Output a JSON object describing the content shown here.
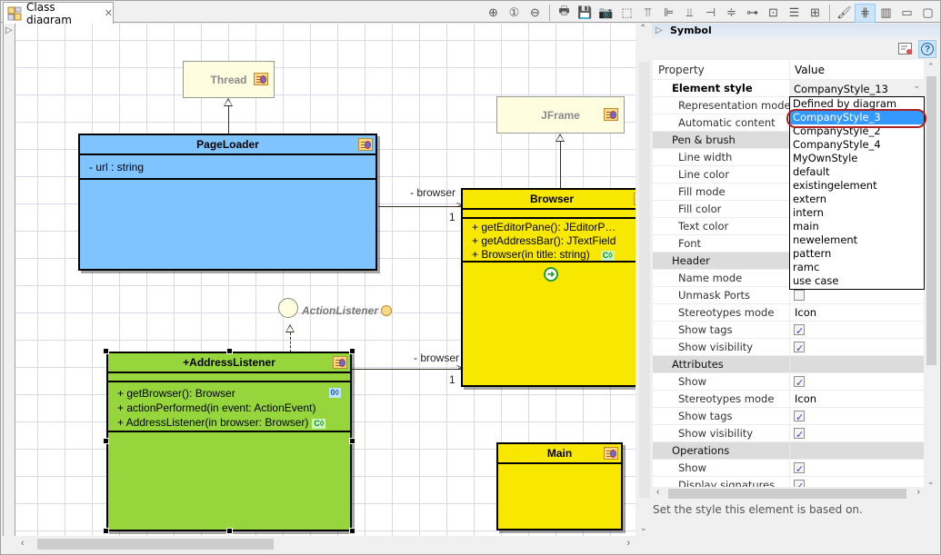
{
  "editor": {
    "tab_label": "Class diagram",
    "tab_icon": "class-diagram-icon",
    "close_glyph": "✕"
  },
  "toolbar": {
    "buttons": [
      {
        "name": "zoom-in",
        "glyph": "⊕"
      },
      {
        "name": "zoom-reset",
        "glyph": "①"
      },
      {
        "name": "zoom-out",
        "glyph": "⊖"
      },
      {
        "name": "print",
        "glyph": "🖶"
      },
      {
        "name": "save",
        "glyph": "💾"
      },
      {
        "name": "screenshot",
        "glyph": "📷"
      },
      {
        "name": "select-area",
        "glyph": "⬚"
      },
      {
        "name": "align-top",
        "glyph": "⫪"
      },
      {
        "name": "align-left",
        "glyph": "⊫"
      },
      {
        "name": "align-bottom",
        "glyph": "⫫"
      },
      {
        "name": "align-right",
        "glyph": "⊣"
      },
      {
        "name": "center-horizontal",
        "glyph": "≑"
      },
      {
        "name": "center-vertical",
        "glyph": "⊶"
      },
      {
        "name": "same-width",
        "glyph": "⊡"
      },
      {
        "name": "same-height",
        "glyph": "☰"
      },
      {
        "name": "same-size",
        "glyph": "⊞"
      },
      {
        "name": "style-brush",
        "glyph": "🖌"
      },
      {
        "name": "grid-toggle",
        "glyph": "⋕"
      },
      {
        "name": "split-view",
        "glyph": "▥"
      },
      {
        "name": "minimize",
        "glyph": "▭"
      },
      {
        "name": "maximize",
        "glyph": "▢"
      }
    ]
  },
  "diagram": {
    "classes": {
      "thread": {
        "name": "Thread"
      },
      "jframe": {
        "name": "JFrame"
      },
      "pageloader": {
        "name": "PageLoader",
        "attributes": [
          "- url : string"
        ],
        "color": "#80c4ff"
      },
      "browser": {
        "name": "Browser",
        "color": "#f8e800",
        "operations": [
          "+ getEditorPane(): JEditorP…",
          "+ getAddressBar(): JTextField",
          "+ Browser(in title: string)"
        ],
        "constructor_badge": "C◊"
      },
      "addresslistener": {
        "name": "+AddressListener",
        "color": "#96d63c",
        "operations": [
          "+ getBrowser(): Browser",
          "+ actionPerformed(in event: ActionEvent)",
          "+ AddressListener(in browser: Browser)"
        ],
        "getter_badge": "0◊",
        "constructor_badge": "C◊"
      },
      "main": {
        "name": "Main",
        "color": "#f8e800"
      }
    },
    "interface": {
      "name": "ActionListener"
    },
    "associations": [
      {
        "role": "- browser",
        "multiplicity": "1"
      },
      {
        "role": "- browser",
        "multiplicity": "1"
      }
    ]
  },
  "properties": {
    "section_title": "Symbol",
    "columns": {
      "property": "Property",
      "value": "Value"
    },
    "element_style": {
      "label": "Element style",
      "value": "CompanyStyle_13"
    },
    "rows": [
      {
        "label": "Representation mode",
        "type": "text",
        "value": ""
      },
      {
        "label": "Automatic content",
        "type": "text",
        "value": ""
      },
      {
        "label": "Pen & brush",
        "type": "category"
      },
      {
        "label": "Line width",
        "type": "text",
        "value": ""
      },
      {
        "label": "Line color",
        "type": "text",
        "value": ""
      },
      {
        "label": "Fill mode",
        "type": "text",
        "value": ""
      },
      {
        "label": "Fill color",
        "type": "text",
        "value": ""
      },
      {
        "label": "Text color",
        "type": "text",
        "value": ""
      },
      {
        "label": "Font",
        "type": "text",
        "value": ""
      },
      {
        "label": "Header",
        "type": "category"
      },
      {
        "label": "Name mode",
        "type": "text",
        "value": ""
      },
      {
        "label": "Unmask Ports",
        "type": "checkbox",
        "checked": false
      },
      {
        "label": "Stereotypes mode",
        "type": "text",
        "value": "Icon"
      },
      {
        "label": "Show tags",
        "type": "checkbox",
        "checked": true
      },
      {
        "label": "Show visibility",
        "type": "checkbox",
        "checked": true
      },
      {
        "label": "Attributes",
        "type": "category"
      },
      {
        "label": "Show",
        "type": "checkbox",
        "checked": true
      },
      {
        "label": "Stereotypes mode",
        "type": "text",
        "value": "Icon"
      },
      {
        "label": "Show tags",
        "type": "checkbox",
        "checked": true
      },
      {
        "label": "Show visibility",
        "type": "checkbox",
        "checked": true
      },
      {
        "label": "Operations",
        "type": "category"
      },
      {
        "label": "Show",
        "type": "checkbox",
        "checked": true
      },
      {
        "label": "Display signatures",
        "type": "checkbox",
        "checked": true
      }
    ],
    "dropdown_options": [
      "Defined by diagram",
      "CompanyStyle_3",
      "CompanyStyle_2",
      "CompanyStyle_4",
      "MyOwnStyle",
      "default",
      "existingelement",
      "extern",
      "intern",
      "main",
      "newelement",
      "pattern",
      "ramc",
      "use case"
    ],
    "highlighted_option": "CompanyStyle_3",
    "description": "Set the style this element is based on."
  }
}
